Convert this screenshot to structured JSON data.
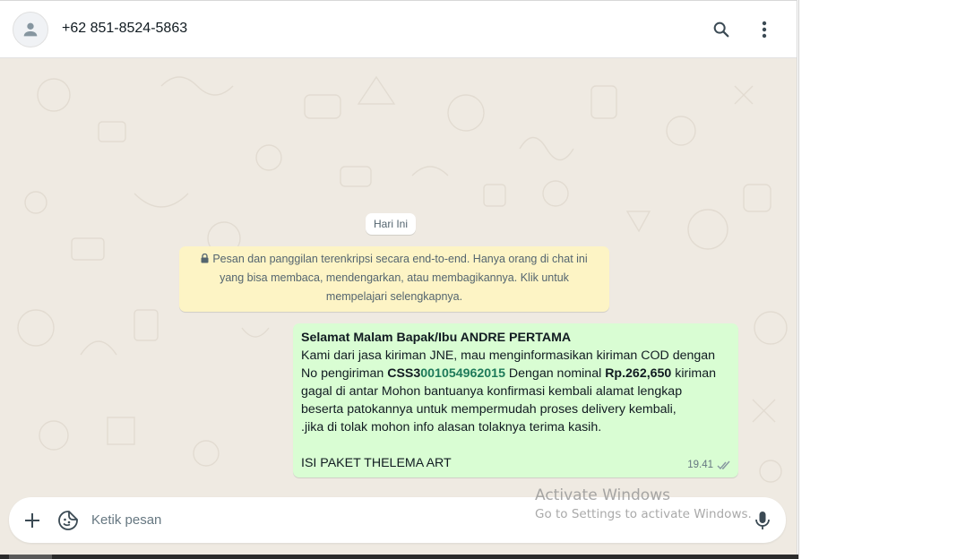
{
  "header": {
    "contact_name": "+62 851-8524-5863",
    "icons": {
      "avatar": "person-icon",
      "search": "search-icon",
      "menu": "more-vertical-icon"
    }
  },
  "chat": {
    "date_chip": "Hari Ini",
    "encryption_notice": {
      "line1": "Pesan dan panggilan terenkripsi secara end-to-end. Hanya orang di chat ini",
      "line2": "yang bisa membaca, mendengarkan, atau membagikannya. Klik untuk",
      "line3": "mempelajari selengkapnya.",
      "icon": "lock-icon"
    },
    "message": {
      "greeting": "Selamat Malam Bapak/Ibu ANDRE PERTAMA",
      "line2": "Kami dari jasa kiriman JNE, mau menginformasikan kiriman COD dengan",
      "line3_prefix": "No pengiriman ",
      "tracking_prefix": "CSS3",
      "tracking_number": "001054962015",
      "line3_mid": " Dengan nominal ",
      "amount": "Rp.262,650",
      "line3_suffix": " kiriman",
      "line4": "gagal di antar Mohon bantuanya konfirmasi kembali alamat lengkap",
      "line5": "beserta patokannya untuk mempermudah proses delivery kembali,",
      "line6": " .jika di tolak mohon info alasan tolaknya terima kasih.",
      "line8": "ISI PAKET THELEMA ART",
      "time": "19.41",
      "status_icon": "double-check-icon"
    }
  },
  "composer": {
    "placeholder": "Ketik pesan",
    "value": "",
    "icons": {
      "attach": "plus-icon",
      "sticker": "sticker-icon",
      "voice": "microphone-icon"
    }
  },
  "watermark": {
    "title": "Activate Windows",
    "subtitle": "Go to Settings to activate Windows."
  },
  "colors": {
    "chat_background": "#efeae2",
    "outgoing_bubble": "#d9fdd3",
    "notice_background": "#fdf4c5",
    "tracking_accent": "#1e7a5a"
  }
}
